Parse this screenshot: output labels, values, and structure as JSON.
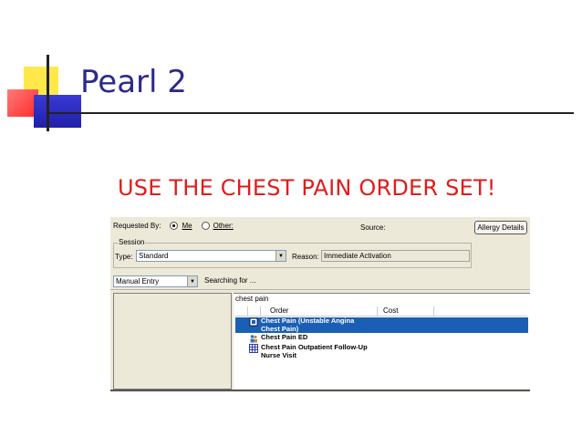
{
  "slide": {
    "title": "Pearl 2",
    "headline": "USE THE CHEST PAIN ORDER SET!",
    "title_color": "#2a2a8c",
    "headline_color": "#e21b1b"
  },
  "app": {
    "requested_by_label": "Requested By:",
    "me_label": "Me",
    "other_label": "Other:",
    "source_label": "Source:",
    "allergy_button": "Allergy Details",
    "session_legend": "Session",
    "type_label": "Type:",
    "type_value": "Standard",
    "reason_label": "Reason:",
    "reason_value": "Immediate Activation",
    "entry_value": "Manual Entry",
    "searching_label": "Searching for ...",
    "search_value": "chest pain",
    "columns": {
      "order": "Order",
      "cost": "Cost"
    },
    "results": [
      {
        "line1": "Chest Pain (Unstable Angina",
        "line2": "Chest Pain)",
        "icon": "order-set-icon",
        "selected": true
      },
      {
        "line1": "Chest Pain ED",
        "line2": "",
        "icon": "people-icon",
        "selected": false
      },
      {
        "line1": "Chest Pain Outpatient Follow-Up",
        "line2": "Nurse Visit",
        "icon": "grid-icon",
        "selected": false
      }
    ],
    "selection_color": "#1a5fb4"
  }
}
